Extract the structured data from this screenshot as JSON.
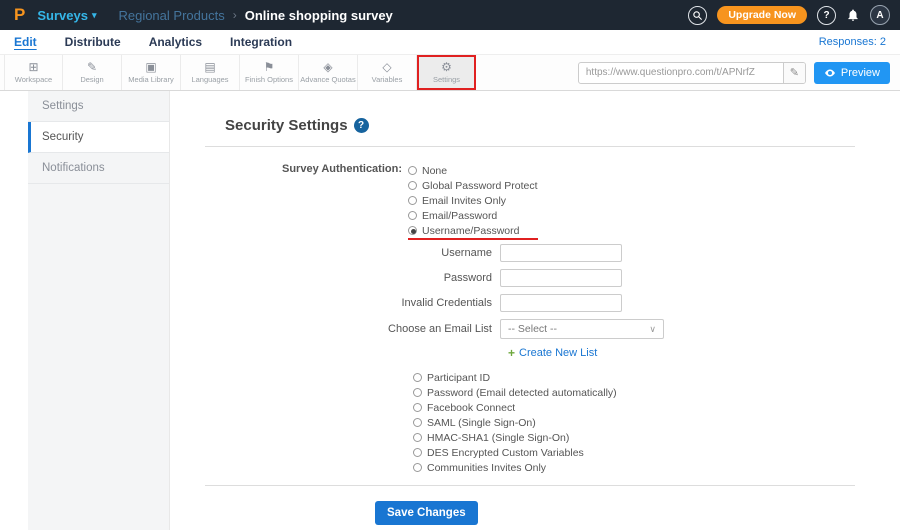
{
  "topbar": {
    "logo_letter": "P",
    "product_menu": "Surveys",
    "breadcrumb": {
      "parent": "Regional Products",
      "separator": "›",
      "current": "Online shopping survey"
    },
    "upgrade_button": "Upgrade Now",
    "help_glyph": "?",
    "avatar_letter": "A"
  },
  "nav": {
    "items": [
      "Edit",
      "Distribute",
      "Analytics",
      "Integration"
    ],
    "responses_label": "Responses: 2"
  },
  "toolbar": {
    "items": [
      {
        "label": "Workspace",
        "icon": "⊞"
      },
      {
        "label": "Design",
        "icon": "✎"
      },
      {
        "label": "Media Library",
        "icon": "▣"
      },
      {
        "label": "Languages",
        "icon": "▤"
      },
      {
        "label": "Finish Options",
        "icon": "⚑"
      },
      {
        "label": "Advance Quotas",
        "icon": "◈"
      },
      {
        "label": "Variables",
        "icon": "◇"
      },
      {
        "label": "Settings",
        "icon": "⚙"
      }
    ],
    "url_value": "https://www.questionpro.com/t/APNrfZ",
    "pencil_icon": "✎",
    "preview_button": "Preview"
  },
  "sidebar": {
    "items": [
      "Settings",
      "Security",
      "Notifications"
    ]
  },
  "main": {
    "title": "Security Settings",
    "help_glyph": "?",
    "auth_label": "Survey Authentication:",
    "auth_options": [
      "None",
      "Global Password Protect",
      "Email Invites Only",
      "Email/Password",
      "Username/Password"
    ],
    "selected_option": "Username/Password",
    "fields": [
      {
        "label": "Username",
        "value": ""
      },
      {
        "label": "Password",
        "value": ""
      },
      {
        "label": "Invalid Credentials",
        "value": ""
      },
      {
        "label": "Choose an Email List",
        "value": "-- Select --"
      }
    ],
    "plus_icon": "+",
    "create_list_link": "Create New List",
    "select_chevron": "∨",
    "more_options": [
      "Participant ID",
      "Password (Email detected automatically)",
      "Facebook Connect",
      "SAML (Single Sign-On)",
      "HMAC-SHA1 (Single Sign-On)",
      "DES Encrypted Custom Variables",
      "Communities Invites Only"
    ],
    "save_button": "Save Changes"
  },
  "colors": {
    "accent_blue": "#1976d2",
    "brand_orange": "#f7941e",
    "annotation_red": "#e02020",
    "topbar_bg": "#1e2732"
  }
}
